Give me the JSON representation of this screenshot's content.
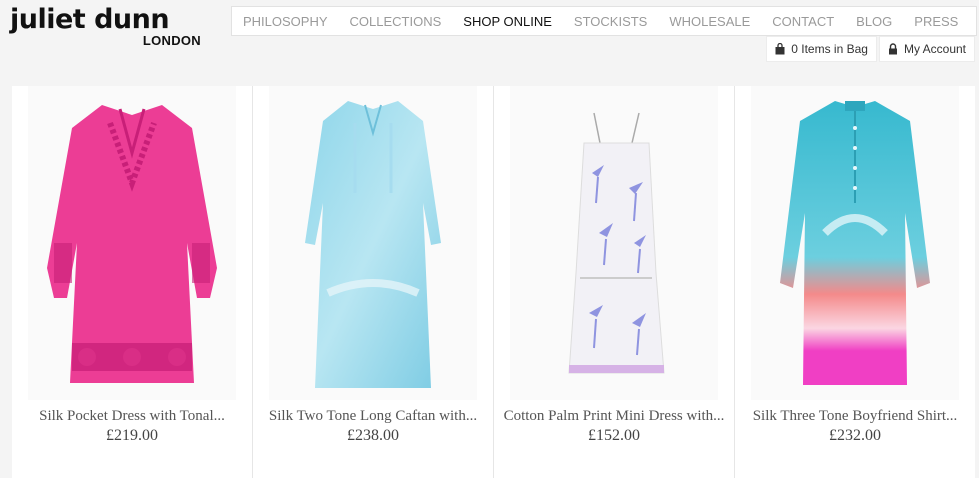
{
  "brand": {
    "name": "juliet dunn",
    "location": "LONDON"
  },
  "nav": {
    "items": [
      {
        "label": "PHILOSOPHY",
        "active": false
      },
      {
        "label": "COLLECTIONS",
        "active": false
      },
      {
        "label": "SHOP ONLINE",
        "active": true
      },
      {
        "label": "STOCKISTS",
        "active": false
      },
      {
        "label": "WHOLESALE",
        "active": false
      },
      {
        "label": "CONTACT",
        "active": false
      },
      {
        "label": "BLOG",
        "active": false
      },
      {
        "label": "PRESS",
        "active": false
      }
    ]
  },
  "account": {
    "bag_label": "0 Items in Bag",
    "bag_icon": "shopping-bag-icon",
    "account_label": "My Account",
    "account_icon": "lock-icon"
  },
  "products": [
    {
      "name": "Silk Pocket Dress with Tonal...",
      "price": "£219.00",
      "color": "#ec3d95"
    },
    {
      "name": "Silk Two Tone Long Caftan with...",
      "price": "£238.00",
      "color": "#8fd6ea"
    },
    {
      "name": "Cotton Palm Print Mini Dress with...",
      "price": "£152.00",
      "color": "#f2f1f6"
    },
    {
      "name": "Silk Three Tone Boyfriend Shirt...",
      "price": "£232.00",
      "color": "#37b9cf"
    }
  ]
}
